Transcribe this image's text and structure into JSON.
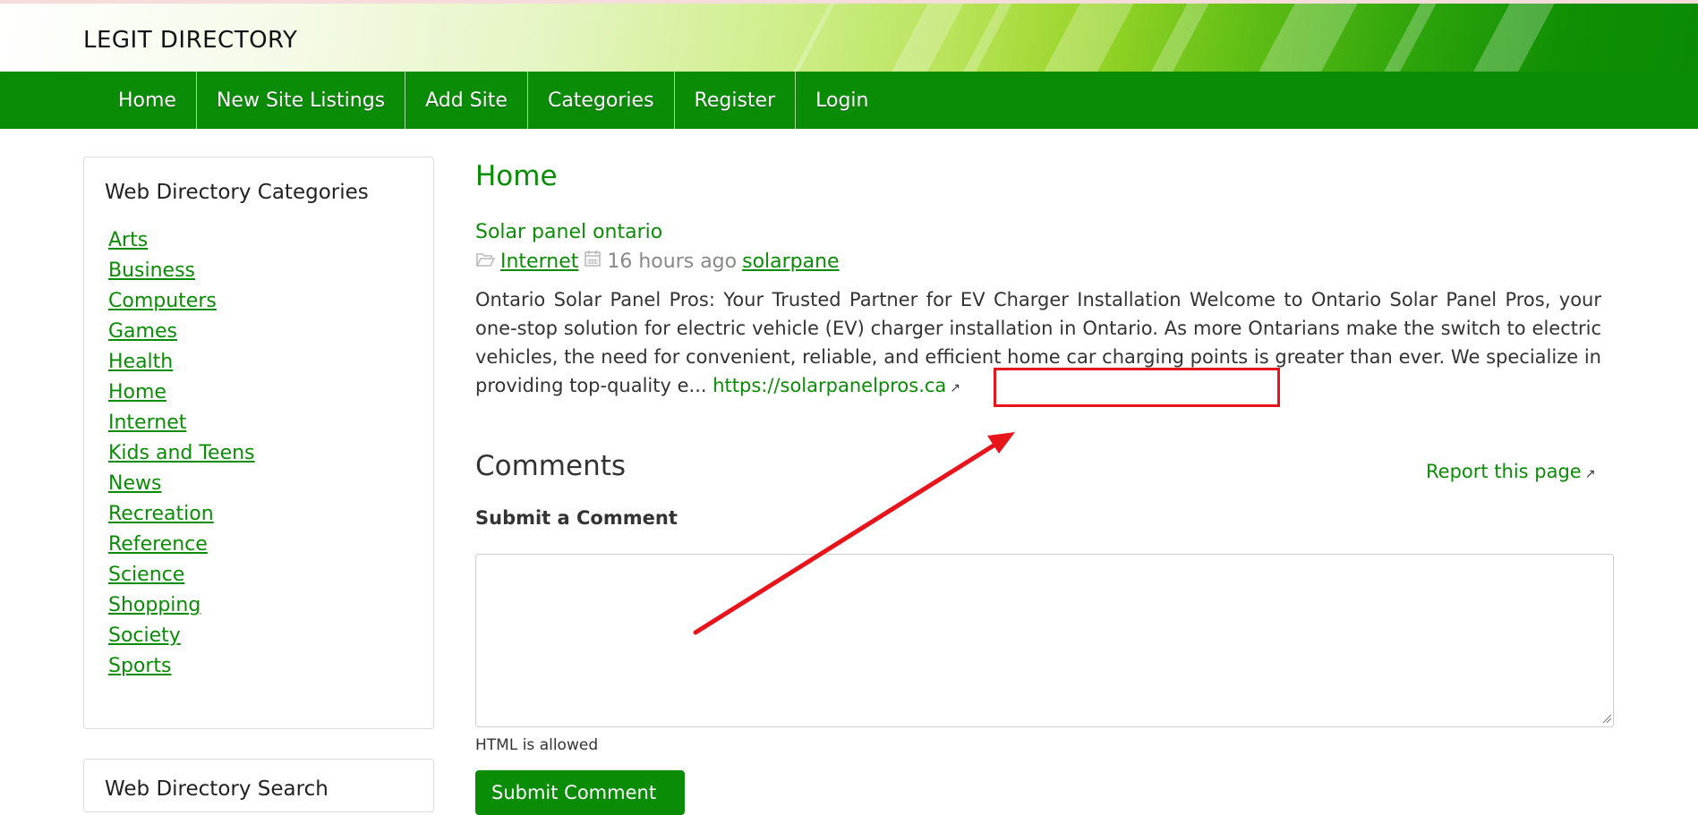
{
  "header": {
    "site_title": "LEGIT DIRECTORY"
  },
  "nav": {
    "items": [
      "Home",
      "New Site Listings",
      "Add Site",
      "Categories",
      "Register",
      "Login"
    ]
  },
  "sidebar": {
    "categories_title": "Web Directory Categories",
    "categories": [
      "Arts",
      "Business",
      "Computers",
      "Games",
      "Health",
      "Home",
      "Internet",
      "Kids and Teens",
      "News",
      "Recreation",
      "Reference",
      "Science",
      "Shopping",
      "Society",
      "Sports"
    ],
    "search_title": "Web Directory Search"
  },
  "main": {
    "heading": "Home",
    "listing": {
      "title": "Solar panel ontario",
      "category": "Internet",
      "time": "16 hours ago",
      "author": "solarpane",
      "description": "Ontario Solar Panel Pros: Your Trusted Partner for EV Charger Installation Welcome to Ontario Solar Panel Pros, your one-stop solution for electric vehicle (EV) charger installation in Ontario. As more Ontarians make the switch to electric vehicles, the need for convenient, reliable, and efficient home car charging points is greater than ever. We specialize in providing top-quality e...",
      "url": "https://solarpanelpros.ca"
    },
    "comments_heading": "Comments",
    "report_link": "Report this page",
    "submit_heading": "Submit a Comment",
    "comment_placeholder": "",
    "html_note": "HTML is allowed",
    "submit_button": "Submit Comment"
  },
  "colors": {
    "brand_green": "#0b8c06",
    "annotation_red": "#e8141b"
  },
  "icons": {
    "category": "folder-open-icon",
    "time": "calendar-icon",
    "external": "external-link-icon"
  }
}
